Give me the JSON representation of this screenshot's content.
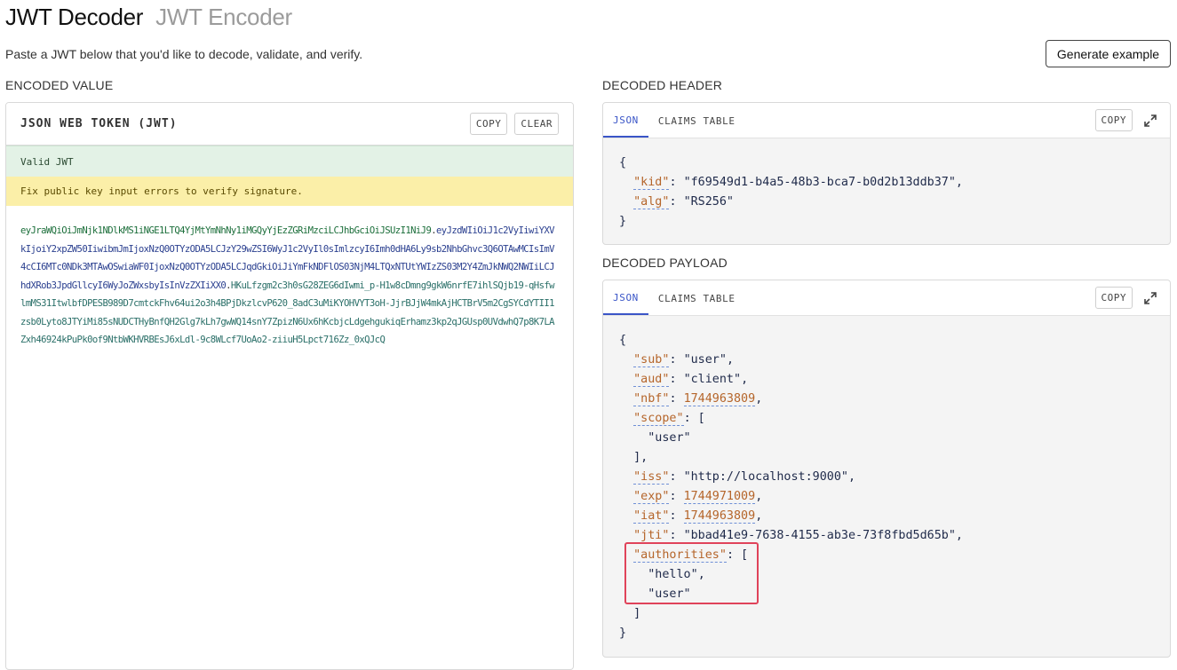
{
  "nav": {
    "active_tab": "JWT Decoder",
    "inactive_tab": "JWT Encoder"
  },
  "subtitle": "Paste a JWT below that you'd like to decode, validate, and verify.",
  "generate_example_label": "Generate example",
  "encoded": {
    "section_label": "ENCODED VALUE",
    "panel_title": "JSON WEB TOKEN (JWT)",
    "copy_label": "COPY",
    "clear_label": "CLEAR",
    "valid_text": "Valid JWT",
    "warning_text": "Fix public key input errors to verify signature.",
    "token_header": "eyJraWQiOiJmNjk1NDlkMS1iNGE1LTQ4YjMtYmNhNy1iMGQyYjEzZGRiMzciLCJhbGciOiJSUzI1NiJ9",
    "token_payload": "eyJzdWIiOiJ1c2VyIiwiYXVkIjoiY2xpZW50IiwibmJmIjoxNzQ0OTYzODA5LCJzY29wZSI6WyJ1c2VyIl0sImlzcyI6Imh0dHA6Ly9sb2NhbGhvc3Q6OTAwMCIsImV4cCI6MTc0NDk3MTAwOSwiaWF0IjoxNzQ0OTYzODA5LCJqdGkiOiJiYmFkNDFlOS03NjM4LTQxNTUtYWIzZS03M2Y4ZmJkNWQ2NWIiLCJhdXRob3JpdGllcyI6WyJoZWxsbyIsInVzZXIiXX0",
    "token_signature": "HKuLfzgm2c3h0sG28ZEG6dIwmi_p-H1w8cDmng9gkW6nrfE7ihlSQjb19-qHsfwlmMS31ItwlbfDPESB989D7cmtckFhv64ui2o3h4BPjDkzlcvP620_8adC3uMiKYOHVYT3oH-JjrBJjW4mkAjHCTBrV5m2CgSYCdYTII1zsb0Lyto8JTYiMi85sNUDCTHyBnfQH2Glg7kLh7gwWQ14snY7ZpizN6Ux6hKcbjcLdgehgukiqErhamz3kp2qJGUsp0UVdwhQ7p8K7LAZxh46924kPuPk0of9NtbWKHVRBEsJ6xLdl-9c8WLcf7UoAo2-ziiuH5Lpct716Zz_0xQJcQ"
  },
  "decoded_header": {
    "section_label": "DECODED HEADER",
    "tabs": [
      "JSON",
      "CLAIMS TABLE"
    ],
    "copy_label": "COPY",
    "lines": {
      "open": "{",
      "kid_key": "\"kid\"",
      "kid_val": "\"f69549d1-b4a5-48b3-bca7-b0d2b13ddb37\"",
      "alg_key": "\"alg\"",
      "alg_val": "\"RS256\"",
      "close": "}"
    }
  },
  "decoded_payload": {
    "section_label": "DECODED PAYLOAD",
    "tabs": [
      "JSON",
      "CLAIMS TABLE"
    ],
    "copy_label": "COPY",
    "lines": {
      "open": "{",
      "sub_key": "\"sub\"",
      "sub_val": "\"user\"",
      "aud_key": "\"aud\"",
      "aud_val": "\"client\"",
      "nbf_key": "\"nbf\"",
      "nbf_val": "1744963809",
      "scope_key": "\"scope\"",
      "scope_item": "\"user\"",
      "iss_key": "\"iss\"",
      "iss_val": "\"http://localhost:9000\"",
      "exp_key": "\"exp\"",
      "exp_val": "1744971009",
      "iat_key": "\"iat\"",
      "iat_val": "1744963809",
      "jti_key": "\"jti\"",
      "jti_val": "\"bbad41e9-7638-4155-ab3e-73f8fbd5d65b\"",
      "authorities_key": "\"authorities\"",
      "auth_item_1": "\"hello\"",
      "auth_item_2": "\"user\"",
      "close": "}"
    }
  }
}
